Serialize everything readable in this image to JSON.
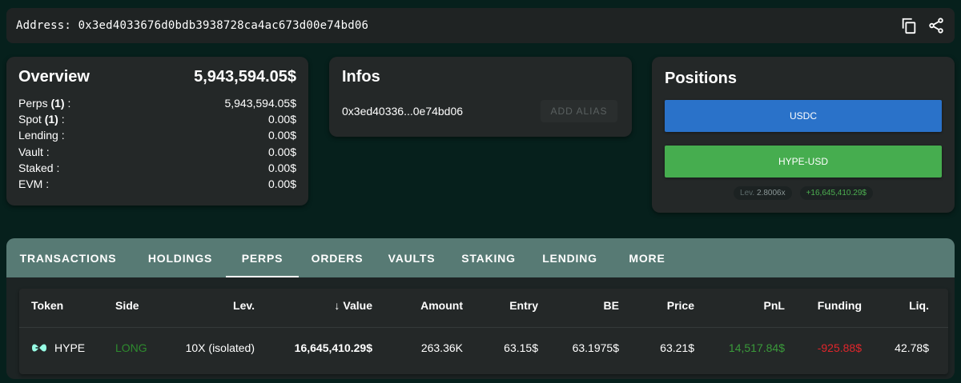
{
  "address_bar": {
    "label": "Address:",
    "value": "0x3ed4033676d0bdb3938728ca4ac673d00e74bd06",
    "copy_icon": "copy-icon",
    "share_icon": "share-icon"
  },
  "overview": {
    "title": "Overview",
    "total": "5,943,594.05$",
    "rows": [
      {
        "label": "Perps",
        "count": "(1)",
        "suffix": " :",
        "value": "5,943,594.05$"
      },
      {
        "label": "Spot",
        "count": "(1)",
        "suffix": " :",
        "value": "0.00$"
      },
      {
        "label": "Lending :",
        "value": "0.00$"
      },
      {
        "label": "Vault :",
        "value": "0.00$"
      },
      {
        "label": "Staked :",
        "value": "0.00$"
      },
      {
        "label": "EVM :",
        "value": "0.00$"
      }
    ]
  },
  "infos": {
    "title": "Infos",
    "short_address": "0x3ed40336...0e74bd06",
    "alias_button": "ADD ALIAS"
  },
  "positions": {
    "title": "Positions",
    "buttons": [
      "USDC",
      "HYPE-USD"
    ],
    "lev_label": "Lev.",
    "lev_value": "2.8006x",
    "pnl": "+16,645,410.29$",
    "colors": {
      "usdc": "#2a72c9",
      "hype": "#46ad4f"
    }
  },
  "tabs": {
    "items": [
      "TRANSACTIONS",
      "HOLDINGS",
      "PERPS",
      "ORDERS",
      "VAULTS",
      "STAKING",
      "LENDING",
      "MORE"
    ],
    "active": "PERPS"
  },
  "table": {
    "headers": {
      "token": "Token",
      "side": "Side",
      "lev": "Lev.",
      "value": "Value",
      "amount": "Amount",
      "entry": "Entry",
      "be": "BE",
      "price": "Price",
      "pnl": "PnL",
      "funding": "Funding",
      "liq": "Liq."
    },
    "rows": [
      {
        "token": "HYPE",
        "token_icon": "hyperliquid-logo-icon",
        "side": "LONG",
        "lev": "10X (isolated)",
        "value": "16,645,410.29$",
        "amount": "263.36K",
        "entry": "63.15$",
        "be": "63.1975$",
        "price": "63.21$",
        "pnl": "14,517.84$",
        "funding": "-925.88$",
        "liq": "42.78$"
      }
    ]
  },
  "colors": {
    "background": "#06201c",
    "tab_bar": "#577a74",
    "long": "#2e8b2e",
    "funding_negative": "#e0262b"
  }
}
